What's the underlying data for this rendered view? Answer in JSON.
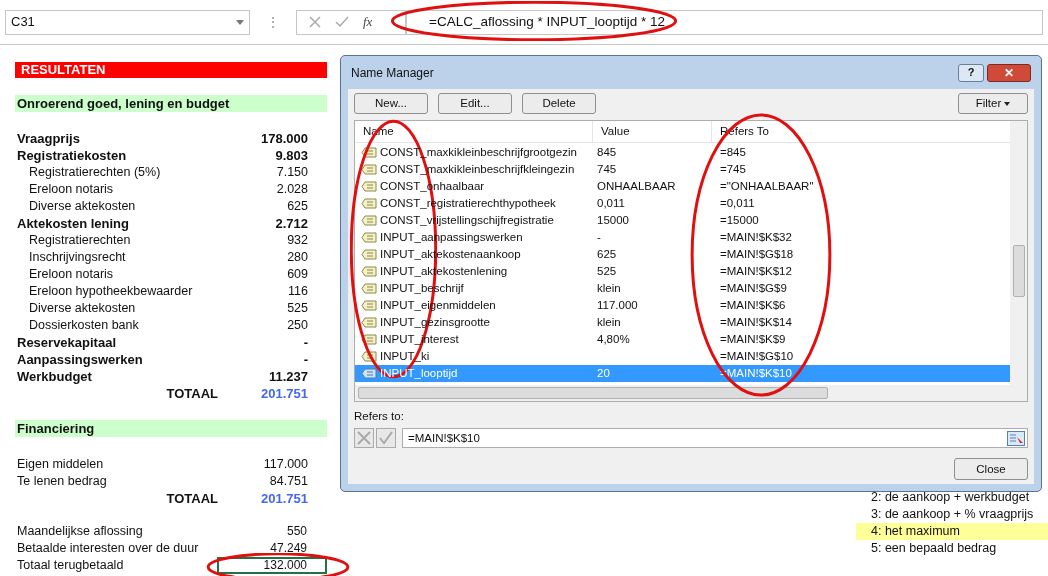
{
  "formula_bar": {
    "name_box": "C31",
    "more": "⋮",
    "fx": "fx",
    "formula": "=CALC_aflossing * INPUT_looptijd * 12"
  },
  "sheet": {
    "title": "RESULTATEN",
    "sections": [
      {
        "heading": "Onroerend goed, lening en budget",
        "rows": [
          {
            "kind": "main",
            "label": "Vraagprijs",
            "value": "178.000"
          },
          {
            "kind": "main",
            "label": "Registratiekosten",
            "value": "9.803"
          },
          {
            "kind": "sub",
            "label": "Registratierechten (5%)",
            "value": "7.150"
          },
          {
            "kind": "sub",
            "label": "Ereloon notaris",
            "value": "2.028"
          },
          {
            "kind": "sub",
            "label": "Diverse aktekosten",
            "value": "625"
          },
          {
            "kind": "main",
            "label": "Aktekosten lening",
            "value": "2.712"
          },
          {
            "kind": "sub",
            "label": "Registratierechten",
            "value": "932"
          },
          {
            "kind": "sub",
            "label": "Inschrijvingsrecht",
            "value": "280"
          },
          {
            "kind": "sub",
            "label": "Ereloon notaris",
            "value": "609"
          },
          {
            "kind": "sub",
            "label": "Ereloon hypotheekbewaarder",
            "value": "116"
          },
          {
            "kind": "sub",
            "label": "Diverse aktekosten",
            "value": "525"
          },
          {
            "kind": "sub",
            "label": "Dossierkosten bank",
            "value": "250"
          },
          {
            "kind": "main",
            "label": "Reservekapitaal",
            "value": "-"
          },
          {
            "kind": "main",
            "label": "Aanpassingswerken",
            "value": "-"
          },
          {
            "kind": "main",
            "label": "Werkbudget",
            "value": "11.237"
          },
          {
            "kind": "total",
            "label": "TOTAAL",
            "value": "201.751"
          }
        ]
      },
      {
        "heading": "Financiering",
        "rows": [
          {
            "kind": "plain",
            "label": "Eigen middelen",
            "value": "117.000"
          },
          {
            "kind": "plain",
            "label": "Te lenen bedrag",
            "value": "84.751"
          },
          {
            "kind": "total",
            "label": "TOTAAL",
            "value": "201.751"
          }
        ]
      }
    ],
    "repayment": [
      {
        "label": "Maandelijkse aflossing",
        "value": "550",
        "selected": false
      },
      {
        "label": "Betaalde interesten over de duur",
        "value": "47.249",
        "selected": false
      },
      {
        "label": "Totaal terugbetaald",
        "value": "132.000",
        "selected": true
      }
    ],
    "options": [
      {
        "label": "2: de aankoop + werkbudget",
        "selected": false
      },
      {
        "label": "3: de aankoop + % vraagprijs",
        "selected": false
      },
      {
        "label": "4: het maximum",
        "selected": true
      },
      {
        "label": "5: een bepaald bedrag",
        "selected": false
      }
    ]
  },
  "dialog": {
    "title": "Name Manager",
    "help": "?",
    "close_glyph": "✕",
    "buttons": [
      "New...",
      "Edit...",
      "Delete"
    ],
    "filter": "Filter",
    "columns": [
      "Name",
      "Value",
      "Refers To"
    ],
    "rows": [
      {
        "name": "CONST_maxkikleinbeschrijfgrootgezin",
        "value": "845",
        "refers_to": "=845",
        "selected": false
      },
      {
        "name": "CONST_maxkikleinbeschrijfkleingezin",
        "value": "745",
        "refers_to": "=745",
        "selected": false
      },
      {
        "name": "CONST_onhaalbaar",
        "value": "ONHAALBAAR",
        "refers_to": "=\"ONHAALBAAR\"",
        "selected": false
      },
      {
        "name": "CONST_registratierechthypotheek",
        "value": "0,011",
        "refers_to": "=0,011",
        "selected": false
      },
      {
        "name": "CONST_vrijstellingschijfregistratie",
        "value": "15000",
        "refers_to": "=15000",
        "selected": false
      },
      {
        "name": "INPUT_aanpassingswerken",
        "value": "-",
        "refers_to": "=MAIN!$K$32",
        "selected": false
      },
      {
        "name": "INPUT_aktekostenaankoop",
        "value": "625",
        "refers_to": "=MAIN!$G$18",
        "selected": false
      },
      {
        "name": "INPUT_aktekostenlening",
        "value": "525",
        "refers_to": "=MAIN!$K$12",
        "selected": false
      },
      {
        "name": "INPUT_beschrijf",
        "value": "klein",
        "refers_to": "=MAIN!$G$9",
        "selected": false
      },
      {
        "name": "INPUT_eigenmiddelen",
        "value": "117.000",
        "refers_to": "=MAIN!$K$6",
        "selected": false
      },
      {
        "name": "INPUT_gezinsgrootte",
        "value": "klein",
        "refers_to": "=MAIN!$K$14",
        "selected": false
      },
      {
        "name": "INPUT_interest",
        "value": "4,80%",
        "refers_to": "=MAIN!$K$9",
        "selected": false
      },
      {
        "name": "INPUT_ki",
        "value": "",
        "refers_to": "=MAIN!$G$10",
        "selected": false
      },
      {
        "name": "INPUT_looptijd",
        "value": "20",
        "refers_to": "=MAIN!$K$10",
        "selected": true
      }
    ],
    "refers_label": "Refers to:",
    "refers_value": "=MAIN!$K$10",
    "close": "Close"
  }
}
